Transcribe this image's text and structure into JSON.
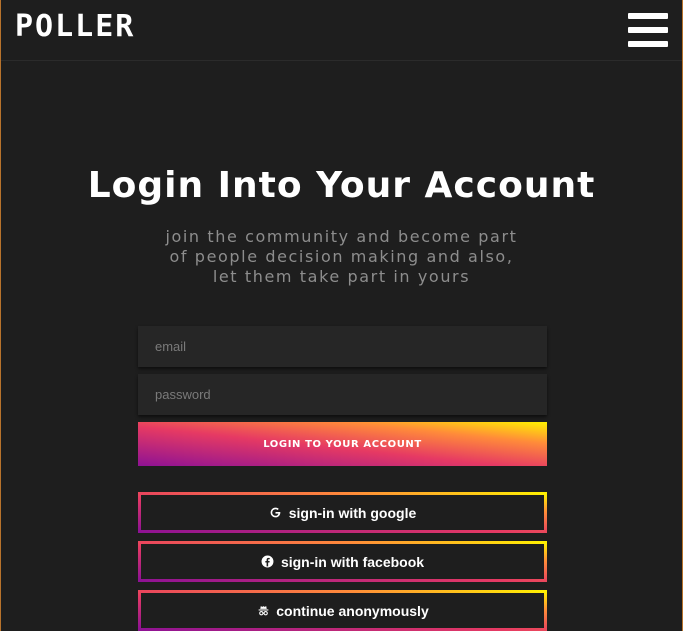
{
  "header": {
    "logo_text": "POLLER",
    "menu_icon": "hamburger-menu-icon"
  },
  "main": {
    "title": "Login Into Your Account",
    "subtitle": "join the community and become part of people decision making and also, let them take part in yours",
    "email_placeholder": "email",
    "password_placeholder": "password",
    "login_label": "LOGIN TO YOUR ACCOUNT",
    "google_label": "sign-in with google",
    "google_icon": "google-icon",
    "facebook_label": "sign-in with facebook",
    "facebook_icon": "facebook-icon",
    "anonymous_label": "continue anonymously",
    "anonymous_icon": "incognito-icon"
  },
  "colors": {
    "background": "#1e1e1e",
    "input_background": "#262626",
    "subtitle_text": "#8d8d8d",
    "gradient_start": "#8e1294",
    "gradient_mid": "#e63a63",
    "gradient_end": "#fff200"
  }
}
